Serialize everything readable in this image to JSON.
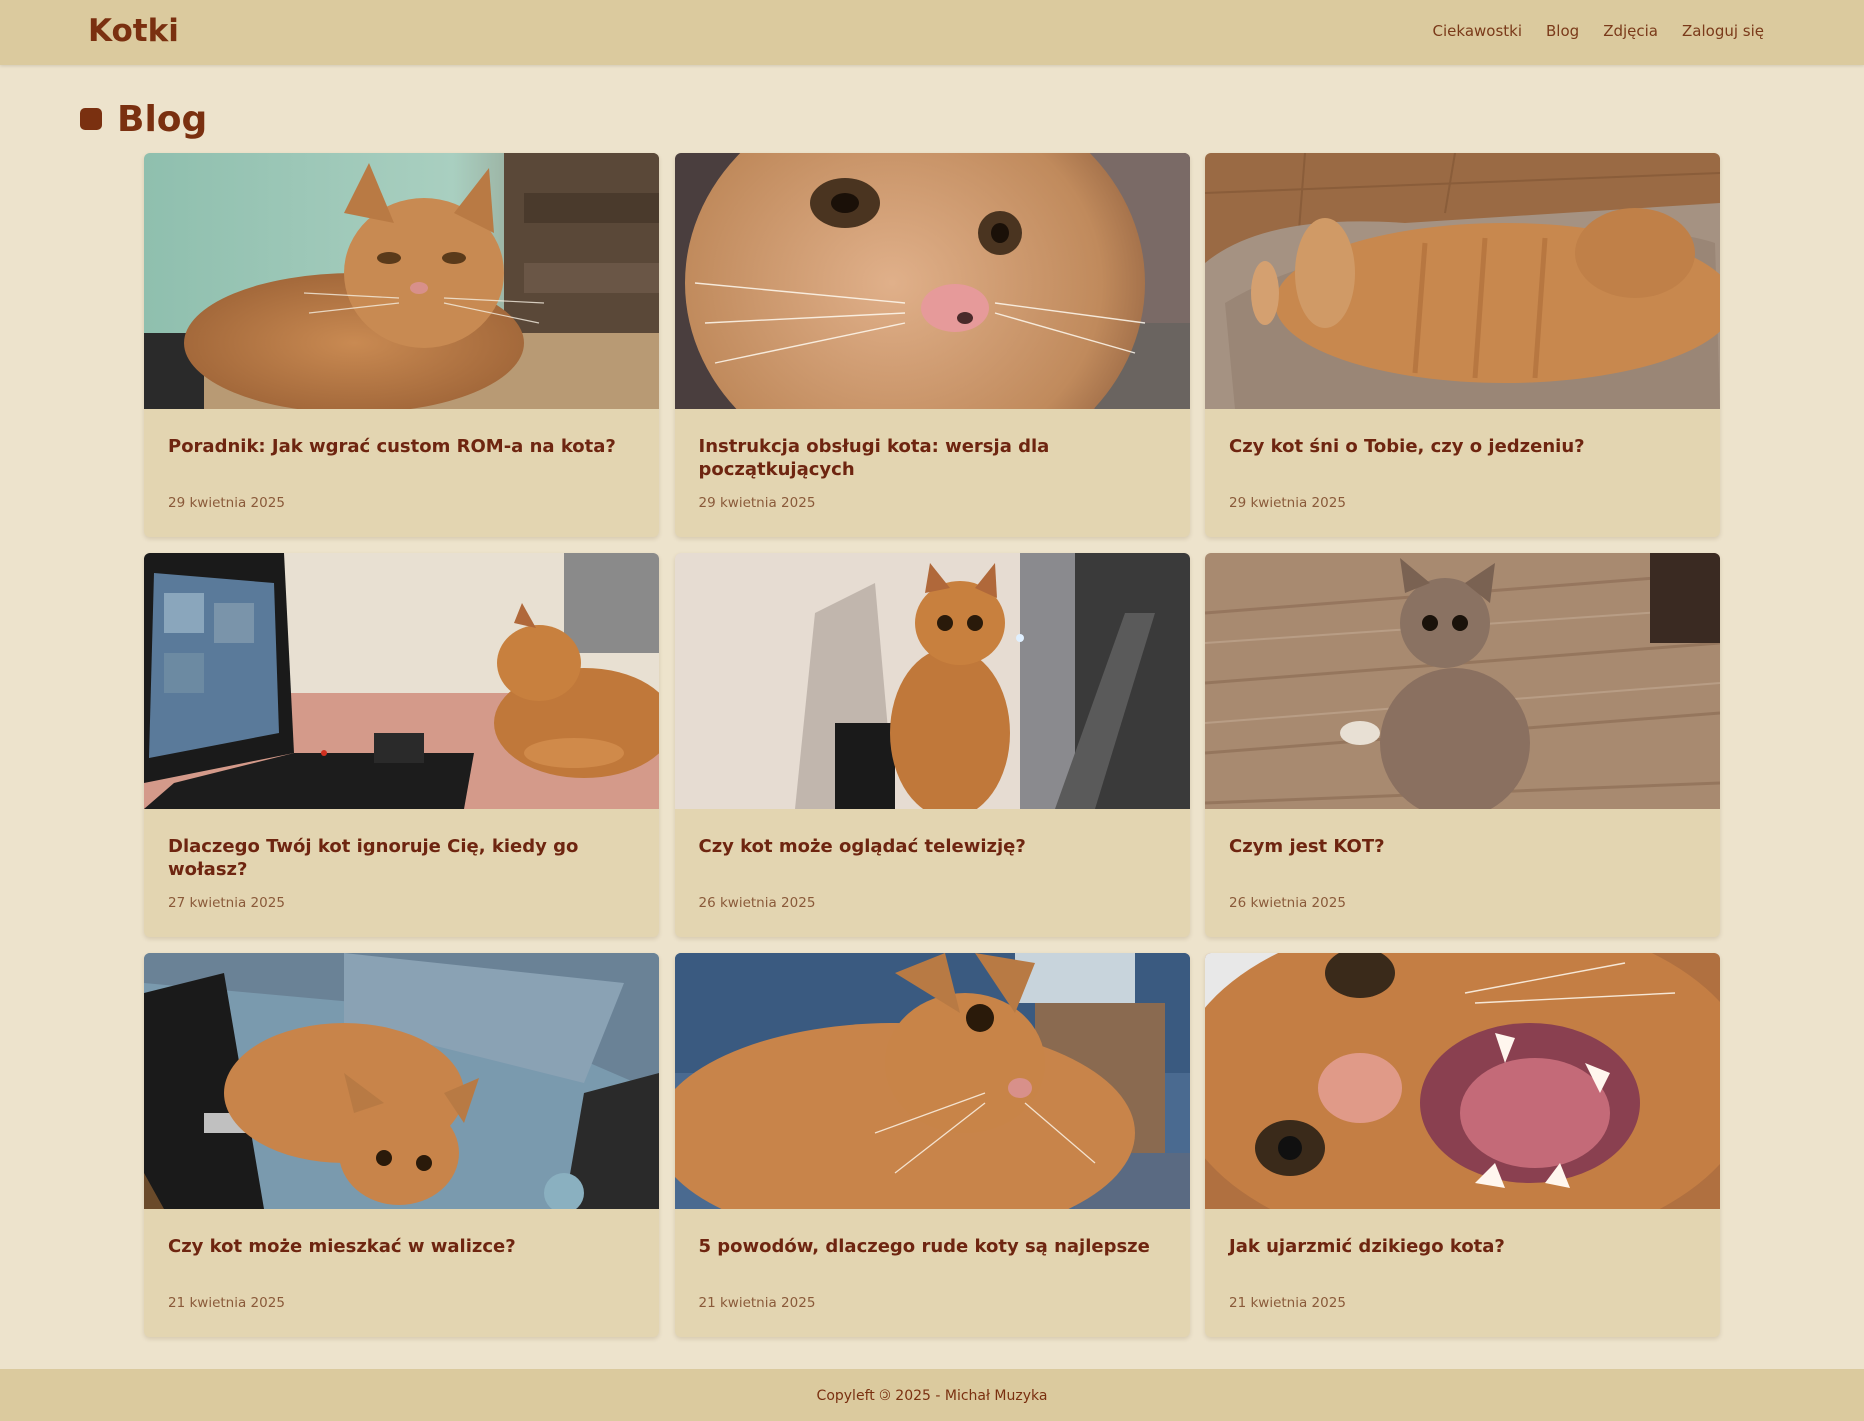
{
  "navbar": {
    "brand": "Kotki",
    "links": [
      "Ciekawostki",
      "Blog",
      "Zdjęcia",
      "Zaloguj się"
    ]
  },
  "page": {
    "heading": "Blog"
  },
  "posts": [
    {
      "title": "Poradnik: Jak wgrać custom ROM-a na kota?",
      "date": "29 kwietnia 2025"
    },
    {
      "title": "Instrukcja obsługi kota: wersja dla początkujących",
      "date": "29 kwietnia 2025"
    },
    {
      "title": "Czy kot śni o Tobie, czy o jedzeniu?",
      "date": "29 kwietnia 2025"
    },
    {
      "title": "Dlaczego Twój kot ignoruje Cię, kiedy go wołasz?",
      "date": "27 kwietnia 2025"
    },
    {
      "title": "Czy kot może oglądać telewizję?",
      "date": "26 kwietnia 2025"
    },
    {
      "title": "Czym jest KOT?",
      "date": "26 kwietnia 2025"
    },
    {
      "title": "Czy kot może mieszkać w walizce?",
      "date": "21 kwietnia 2025"
    },
    {
      "title": "5 powodów, dlaczego rude koty są najlepsze",
      "date": "21 kwietnia 2025"
    },
    {
      "title": "Jak ujarzmić dzikiego kota?",
      "date": "21 kwietnia 2025"
    }
  ],
  "footer": {
    "text": "Copyleft 🄯 2025 - Michał Muzyka"
  },
  "colors": {
    "background": "#ede3cc",
    "navbar": "#dbca9e",
    "card": "#e3d5b1",
    "accent": "#7a3010"
  }
}
